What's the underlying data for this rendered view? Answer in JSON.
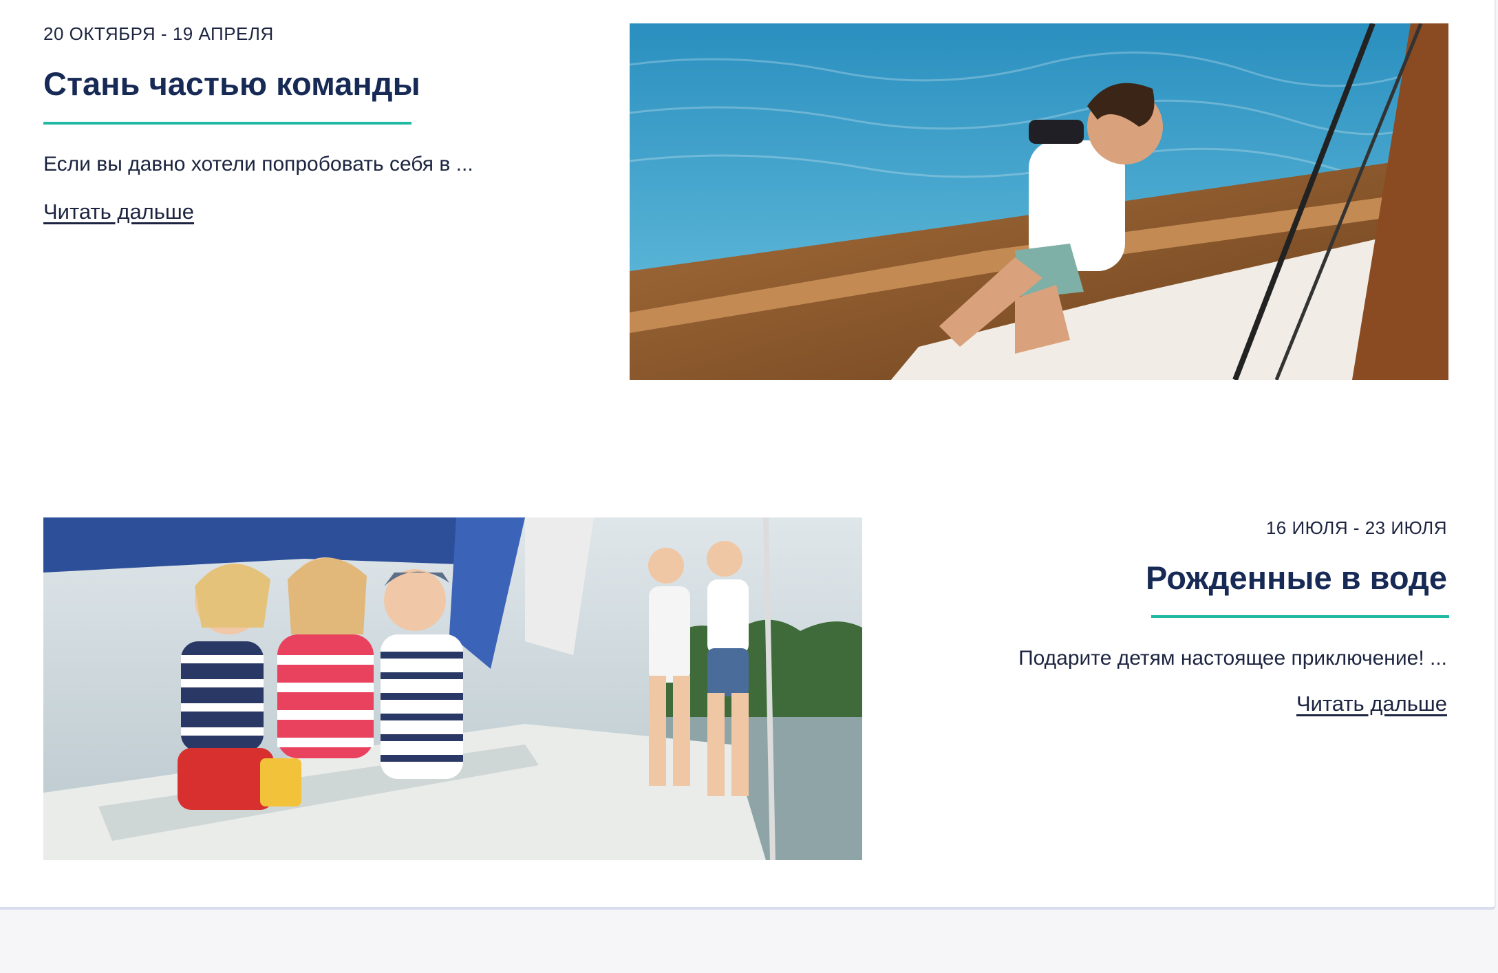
{
  "events": [
    {
      "date": "20 ОКТЯБРЯ - 19 АПРЕЛЯ",
      "title": "Стань частью команды",
      "excerpt": "Если вы давно хотели попробовать себя в ...",
      "read_more": "Читать дальше",
      "image": "man-with-binoculars-on-sailboat-photo"
    },
    {
      "date": "16 ИЮЛЯ - 23 ИЮЛЯ",
      "title": "Рожденные в воде",
      "excerpt": "Подарите детям настоящее приключение! ...",
      "read_more": "Читать дальше",
      "image": "children-on-yacht-deck-photo"
    }
  ],
  "colors": {
    "title": "#172a55",
    "accent_underline": "#1fb9a4",
    "text": "#1c2440",
    "page_background": "#f6f6f8"
  }
}
